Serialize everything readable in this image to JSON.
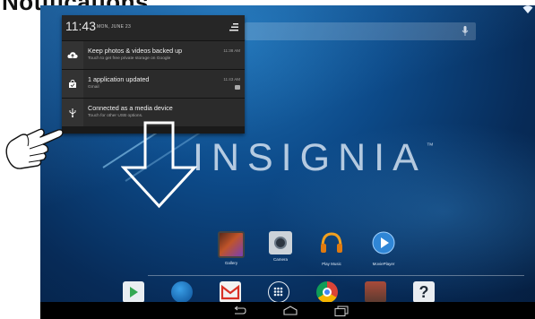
{
  "page_heading": "Notifications",
  "status": {
    "time": "11:43",
    "date": "MON, JUNE 23"
  },
  "notifications": [
    {
      "title": "Keep photos & videos backed up",
      "subtitle": "Touch to get free private storage on Google",
      "time": "11:38 AM",
      "icon": "cloud-upload-icon"
    },
    {
      "title": "1 application updated",
      "subtitle": "Gmail",
      "time": "11:43 AM",
      "icon": "shopping-bag-icon"
    },
    {
      "title": "Connected as a media device",
      "subtitle": "Touch for other USB options.",
      "time": "",
      "icon": "usb-icon"
    }
  ],
  "brand": "INSIGNIA",
  "brand_mark": "™",
  "apps": [
    {
      "label": "Gallery",
      "icon": "gallery-icon"
    },
    {
      "label": "Camera",
      "icon": "camera-icon"
    },
    {
      "label": "Play Music",
      "icon": "headphones-icon"
    },
    {
      "label": "MoviePlayer",
      "icon": "play-icon"
    }
  ],
  "dock": [
    "play-store-icon",
    "globe-icon",
    "gmail-icon",
    "app-drawer-icon",
    "chrome-icon",
    "media-icon",
    "help-icon"
  ],
  "help_glyph": "?",
  "colors": {
    "panel_bg": "#1a1a1a",
    "wallpaper": "#0d4b8a",
    "accent_blue": "#3fa3e8"
  }
}
